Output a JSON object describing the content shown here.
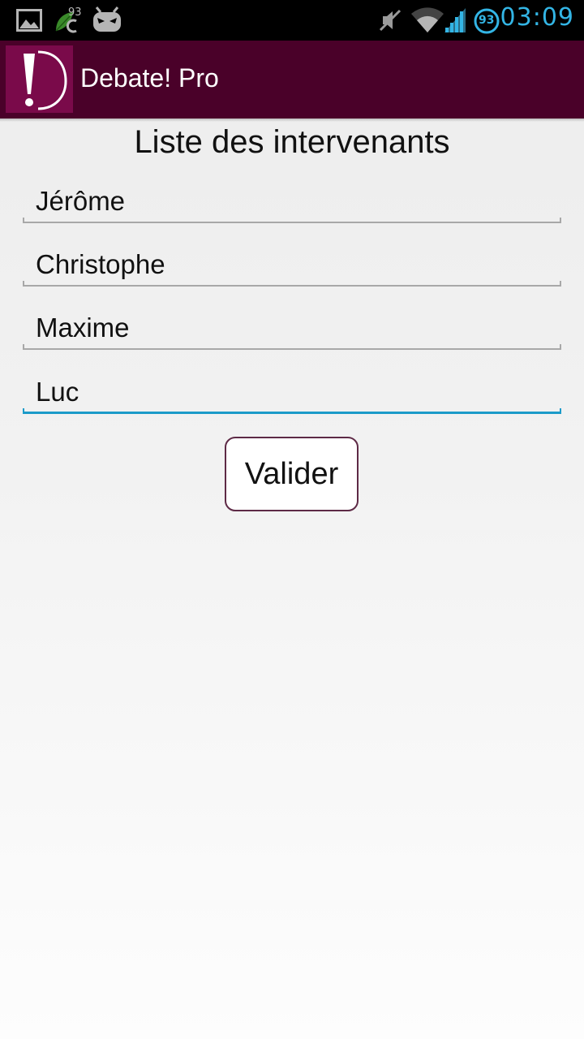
{
  "status_bar": {
    "time": "03:09",
    "battery_badge": "93",
    "notification_badge": "93",
    "icons": [
      "gallery-icon",
      "leaf-icon",
      "android-mask-icon",
      "mute-icon",
      "wifi-icon",
      "signal-icon",
      "battery-icon"
    ],
    "clock_color": "#33b5e5"
  },
  "action_bar": {
    "app_title": "Debate! Pro",
    "background_color": "#4a0129"
  },
  "page": {
    "heading": "Liste des intervenants"
  },
  "participants": [
    {
      "value": "Jérôme",
      "focused": false
    },
    {
      "value": "Christophe",
      "focused": false
    },
    {
      "value": "Maxime",
      "focused": false
    },
    {
      "value": "Luc",
      "focused": true
    }
  ],
  "submit": {
    "label": "Valider"
  }
}
